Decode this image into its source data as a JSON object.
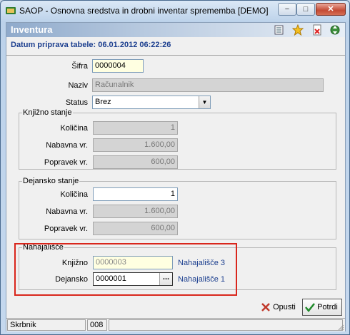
{
  "window": {
    "title": "SAOP -  Osnovna sredstva in drobni inventar sprememba [DEMO]",
    "min_glyph": "−",
    "max_glyph": "□",
    "close_glyph": "✕"
  },
  "header": {
    "title": "Inventura",
    "icons": [
      "list-icon",
      "star-icon",
      "delete-icon",
      "refresh-icon"
    ]
  },
  "date_line": "Datum priprava tabele: 06.01.2012 06:22:26",
  "form": {
    "sifra_label": "Šifra",
    "sifra_value": "0000004",
    "naziv_label": "Naziv",
    "naziv_value": "Računalnik",
    "status_label": "Status",
    "status_value": "Brez"
  },
  "knjizno_stanje": {
    "title": "Knjižno stanje",
    "kolicina_label": "Količina",
    "kolicina_value": "1",
    "nabavna_label": "Nabavna vr.",
    "nabavna_value": "1.600,00",
    "popravek_label": "Popravek vr.",
    "popravek_value": "600,00"
  },
  "dejansko_stanje": {
    "title": "Dejansko stanje",
    "kolicina_label": "Količina",
    "kolicina_value": "1",
    "nabavna_label": "Nabavna vr.",
    "nabavna_value": "1.600,00",
    "popravek_label": "Popravek vr.",
    "popravek_value": "600,00"
  },
  "nahajalisce": {
    "title": "Nahajališče",
    "knjizno_label": "Knjižno",
    "knjizno_value": "0000003",
    "knjizno_name": "Nahajališče 3",
    "dejansko_label": "Dejansko",
    "dejansko_value": "0000001",
    "dejansko_name": "Nahajališče 1",
    "lookup_glyph": "..."
  },
  "buttons": {
    "cancel_label": "Opusti",
    "ok_label": "Potrdi"
  },
  "status_bar": {
    "user": "Skrbnik",
    "code": "008"
  },
  "colors": {
    "highlight": "#d9261c",
    "link": "#1c3f8f",
    "header_gradient_start": "#8faacb"
  }
}
